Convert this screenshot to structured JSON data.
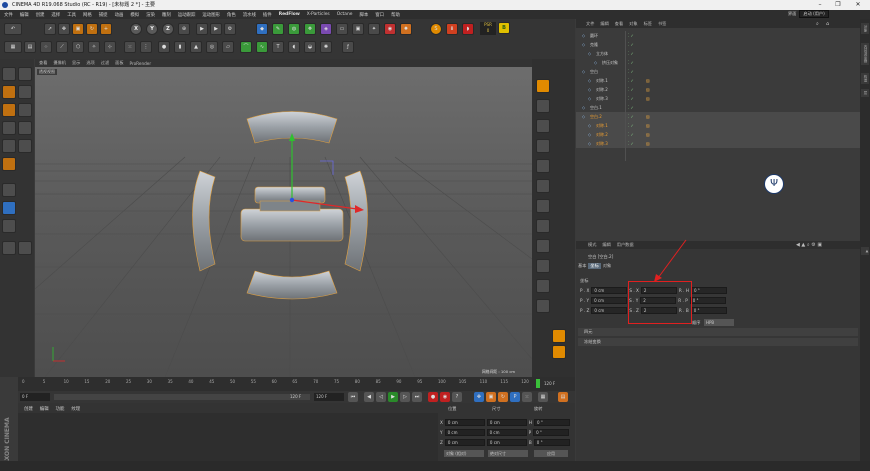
{
  "window": {
    "title": "CINEMA 4D R19.068 Studio (RC - R19) - [未标题 2 *] - 主要",
    "min": "–",
    "max": "❐",
    "close": "✕"
  },
  "menubar": [
    "文件",
    "编辑",
    "创建",
    "选择",
    "工具",
    "网格",
    "捕捉",
    "动画",
    "模拟",
    "渲染",
    "雕刻",
    "运动跟踪",
    "运动图形",
    "角色",
    "流水线",
    "插件",
    "RedFlow",
    "X-Particles",
    "Octane",
    "脚本",
    "窗口",
    "帮助"
  ],
  "layout": {
    "label": "界面",
    "value": "启动 (用户)"
  },
  "toolbar": {
    "x": "X",
    "y": "Y",
    "z": "Z",
    "psr": "PSR",
    "psr_val": "0"
  },
  "viewport": {
    "menu": [
      "查看",
      "摄像机",
      "显示",
      "选项",
      "过滤",
      "面板",
      "ProRender"
    ],
    "tag": "透视视图",
    "grid_scale": "网格间距 : 100 cm"
  },
  "timeline": {
    "ticks": [
      "0",
      "5",
      "10",
      "15",
      "20",
      "25",
      "30",
      "35",
      "40",
      "45",
      "50",
      "55",
      "60",
      "65",
      "70",
      "75",
      "80",
      "85",
      "90",
      "95",
      "100",
      "105",
      "110",
      "115",
      "120"
    ],
    "end": "120 F"
  },
  "playback": {
    "start": "0 F",
    "current": "0 F",
    "end_a": "120 F",
    "end_b": "120 F"
  },
  "material_panel": {
    "menu": [
      "创建",
      "编辑",
      "功能",
      "纹理"
    ]
  },
  "brand": "MAXON CINEMA 4D",
  "coords": {
    "headers": [
      "位置",
      "尺寸",
      "旋转"
    ],
    "rows": [
      {
        "axis": "X",
        "pos": "0 cm",
        "size": "0 cm",
        "rot_lbl": "H",
        "rot": "0 °"
      },
      {
        "axis": "Y",
        "pos": "0 cm",
        "size": "0 cm",
        "rot_lbl": "P",
        "rot": "0 °"
      },
      {
        "axis": "Z",
        "pos": "0 cm",
        "size": "0 cm",
        "rot_lbl": "B",
        "rot": "0 °"
      }
    ],
    "mode": "对象 (相对)",
    "size_mode": "绝对尺寸",
    "apply": "应用"
  },
  "object_manager": {
    "menu": [
      "文件",
      "编辑",
      "查看",
      "对象",
      "标签",
      "书签"
    ],
    "objects": [
      {
        "name": "圆环",
        "indent": 0,
        "color": "normal",
        "selected": false
      },
      {
        "name": "克隆",
        "indent": 0,
        "color": "normal",
        "selected": false
      },
      {
        "name": "立方体",
        "indent": 1,
        "color": "normal",
        "selected": false
      },
      {
        "name": "挤压对象",
        "indent": 2,
        "color": "normal",
        "selected": false
      },
      {
        "name": "空白",
        "indent": 0,
        "color": "normal",
        "selected": false
      },
      {
        "name": "对称.1",
        "indent": 1,
        "color": "normal",
        "selected": false
      },
      {
        "name": "对称.2",
        "indent": 1,
        "color": "normal",
        "selected": false
      },
      {
        "name": "对称.3",
        "indent": 1,
        "color": "normal",
        "selected": false
      },
      {
        "name": "空白.1",
        "indent": 0,
        "color": "normal",
        "selected": false
      },
      {
        "name": "空白.2",
        "indent": 0,
        "color": "orange",
        "selected": true
      },
      {
        "name": "对称.1",
        "indent": 1,
        "color": "orange",
        "selected": true
      },
      {
        "name": "对称.2",
        "indent": 1,
        "color": "orange",
        "selected": true
      },
      {
        "name": "对称.3",
        "indent": 1,
        "color": "orange",
        "selected": true
      }
    ]
  },
  "attributes": {
    "menu": [
      "模式",
      "编辑",
      "用户数据"
    ],
    "object_title": "空白 [空白.2]",
    "tabs": [
      "基本",
      "坐标",
      "对象"
    ],
    "section": "坐标",
    "rows": [
      {
        "p_lbl": "P . X",
        "p": "0 cm",
        "s_lbl": "S . X",
        "s": "2",
        "r_lbl": "R . H",
        "r": "0 °"
      },
      {
        "p_lbl": "P . Y",
        "p": "0 cm",
        "s_lbl": "S . Y",
        "s": "2",
        "r_lbl": "R . P",
        "r": "0 °"
      },
      {
        "p_lbl": "P . Z",
        "p": "0 cm",
        "s_lbl": "S . Z",
        "s": "2",
        "r_lbl": "R . B",
        "r": "0 °"
      }
    ],
    "order_lbl": "顺序",
    "order_val": "HPB",
    "sections": [
      "四元",
      "冻结变换"
    ]
  },
  "side_tabs": [
    "对象",
    "内容浏览器",
    "构造",
    "层"
  ]
}
